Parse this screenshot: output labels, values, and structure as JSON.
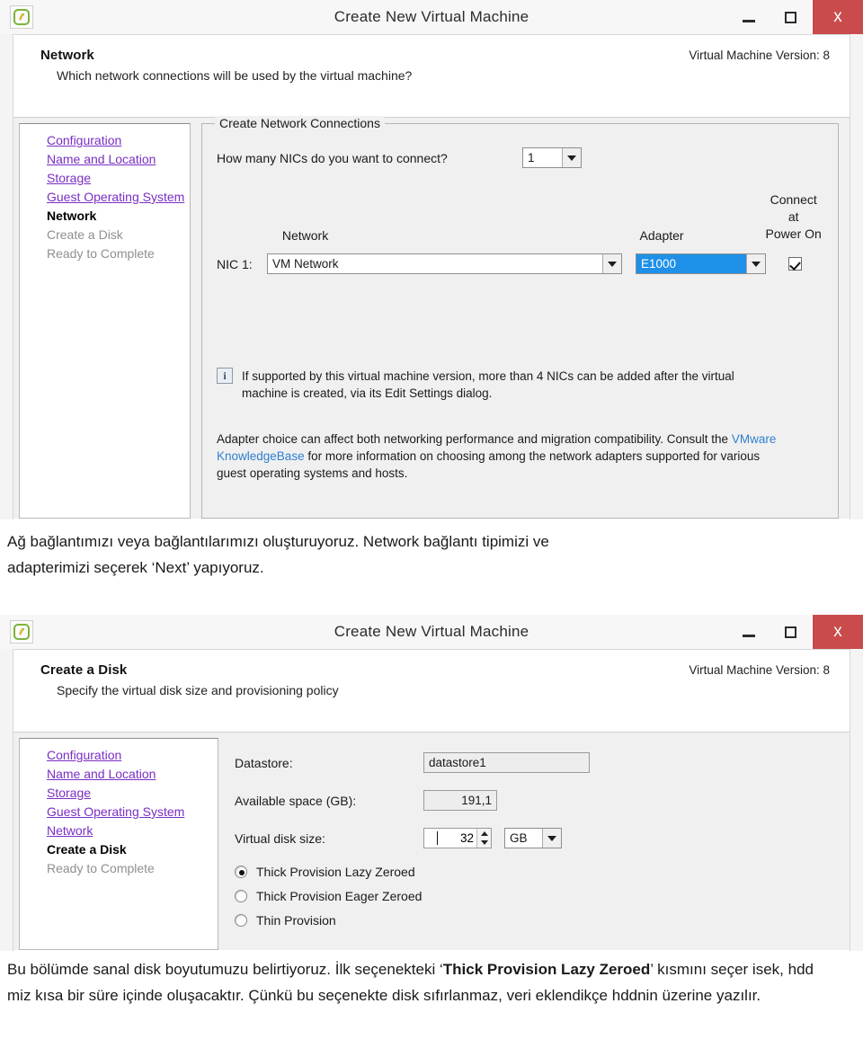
{
  "dialog1": {
    "titlebar": {
      "title": "Create New Virtual Machine",
      "app_icon": "vmware-app-icon",
      "minimize_label": "–",
      "maximize_label": "□",
      "close_label": "x",
      "close_color": "#c94b4b"
    },
    "header": {
      "title": "Network",
      "subtitle": "Which network connections will be used by the virtual machine?",
      "version": "Virtual Machine Version: 8"
    },
    "sidebar": {
      "items": [
        {
          "label": "Configuration",
          "state": "done"
        },
        {
          "label": "Name and Location",
          "state": "done"
        },
        {
          "label": "Storage",
          "state": "done"
        },
        {
          "label": "Guest Operating System",
          "state": "done"
        },
        {
          "label": "Network",
          "state": "current"
        },
        {
          "label": "Create a Disk",
          "state": "todo"
        },
        {
          "label": "Ready to Complete",
          "state": "todo"
        }
      ]
    },
    "groupbox": {
      "legend": "Create Network Connections",
      "nic_question": "How many NICs do you want to connect?",
      "nic_count": "1",
      "col_network": "Network",
      "col_adapter": "Adapter",
      "col_connect_line1": "Connect at",
      "col_connect_line2": "Power On",
      "nic_row_label": "NIC 1:",
      "network_value": "VM Network",
      "adapter_value": "E1000",
      "connect_checked": true,
      "info_icon": "info-icon",
      "info_text": "If supported by this virtual machine version, more than 4 NICs can be added after the virtual machine is created, via its Edit Settings dialog.",
      "note_part1": "Adapter choice can affect both networking performance and migration compatibility. Consult the ",
      "note_link": "VMware KnowledgeBase",
      "note_part2": " for more information on choosing among the network adapters supported for various guest operating systems and hosts."
    }
  },
  "caption1": {
    "line1": "Ağ bağlantımızı veya bağlantılarımızı oluşturuyoruz. Network bağlantı tipimizi ve",
    "line2": "adapterimizi seçerek ‘Next’ yapıyoruz."
  },
  "dialog2": {
    "titlebar": {
      "title": "Create New Virtual Machine",
      "app_icon": "vmware-app-icon",
      "minimize_label": "–",
      "maximize_label": "□",
      "close_label": "x",
      "close_color": "#c94b4b"
    },
    "header": {
      "title": "Create a Disk",
      "subtitle": "Specify the virtual disk size and provisioning policy",
      "version": "Virtual Machine Version: 8"
    },
    "sidebar": {
      "items": [
        {
          "label": "Configuration",
          "state": "done"
        },
        {
          "label": "Name and Location",
          "state": "done"
        },
        {
          "label": "Storage",
          "state": "done"
        },
        {
          "label": "Guest Operating System",
          "state": "done"
        },
        {
          "label": "Network",
          "state": "done"
        },
        {
          "label": "Create a Disk",
          "state": "current"
        },
        {
          "label": "Ready to Complete",
          "state": "todo"
        }
      ]
    },
    "form": {
      "datastore_label": "Datastore:",
      "datastore_value": "datastore1",
      "available_label": "Available space (GB):",
      "available_value": "191,1",
      "disksize_label": "Virtual disk size:",
      "disksize_value": "32",
      "disksize_unit": "GB",
      "provisioning": [
        {
          "label": "Thick Provision Lazy Zeroed",
          "selected": true
        },
        {
          "label": "Thick Provision Eager Zeroed",
          "selected": false
        },
        {
          "label": "Thin Provision",
          "selected": false
        }
      ]
    }
  },
  "caption2": {
    "seg1": "Bu bölümde sanal disk boyutumuzu belirtiyoruz. İlk seçenekteki ‘",
    "seg2_bold": "Thick Provision Lazy Zeroed",
    "seg3": "’ kısmını seçer isek, hdd miz kısa bir süre içinde oluşacaktır. Çünkü bu seçenekte disk sıfırlanmaz, veri eklendikçe hddnin üzerine yazılır."
  }
}
